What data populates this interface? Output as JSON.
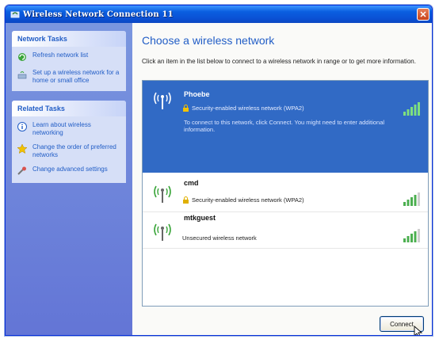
{
  "window": {
    "title": "Wireless Network Connection 11",
    "close_glyph": "✕"
  },
  "sidebar": {
    "network_tasks": {
      "heading": "Network Tasks",
      "items": [
        {
          "label": "Refresh network list",
          "icon": "refresh-icon"
        },
        {
          "label": "Set up a wireless network for a home or small office",
          "icon": "setup-network-icon"
        }
      ]
    },
    "related_tasks": {
      "heading": "Related Tasks",
      "items": [
        {
          "label": "Learn about wireless networking",
          "icon": "info-icon"
        },
        {
          "label": "Change the order of preferred networks",
          "icon": "star-icon"
        },
        {
          "label": "Change advanced settings",
          "icon": "settings-icon"
        }
      ]
    }
  },
  "main": {
    "title": "Choose a wireless network",
    "description": "Click an item in the list below to connect to a wireless network in range or to get more information.",
    "networks": [
      {
        "ssid": "Phoebe",
        "security": "Security-enabled wireless network (WPA2)",
        "message": "To connect to this network, click Connect. You might need to enter additional information.",
        "signal_bars": 5,
        "selected": true
      },
      {
        "ssid": "cmd",
        "security": "Security-enabled wireless network (WPA2)",
        "signal_bars": 4,
        "selected": false
      },
      {
        "ssid": "mtkguest",
        "security": "Unsecured wireless network",
        "signal_bars": 4,
        "selected": false
      }
    ],
    "connect_label": "Connect"
  },
  "colors": {
    "title_bar": "#0a52d6",
    "selection": "#316ac5",
    "link": "#215dc6",
    "signal": "#4caf50"
  }
}
